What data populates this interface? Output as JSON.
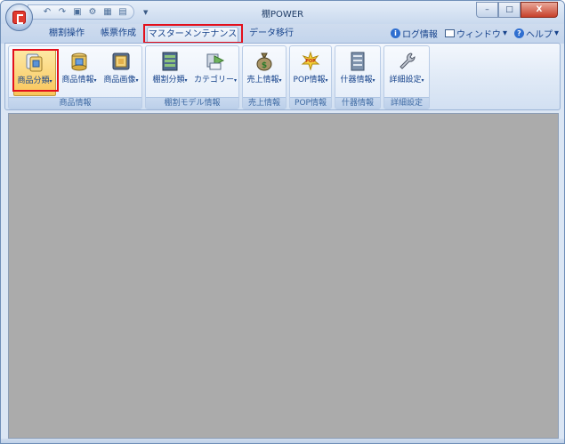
{
  "window": {
    "title": "棚POWER",
    "controls": {
      "minimize": "–",
      "maximize": "□",
      "close": "X"
    }
  },
  "quick_access": {
    "items": [
      {
        "name": "undo-icon",
        "glyph": "↶"
      },
      {
        "name": "redo-icon",
        "glyph": "↷"
      },
      {
        "name": "save-icon",
        "glyph": "▣"
      },
      {
        "name": "tool-icon",
        "glyph": "⚙"
      },
      {
        "name": "grid-icon",
        "glyph": "▦"
      },
      {
        "name": "layout-icon",
        "glyph": "▤"
      }
    ],
    "dropdown": "▼"
  },
  "tabs": [
    {
      "label": "棚割操作",
      "active": false
    },
    {
      "label": "帳票作成",
      "active": false
    },
    {
      "label": "マスターメンテナンス",
      "active": true
    },
    {
      "label": "データ移行",
      "active": false
    }
  ],
  "right_menu": {
    "log": "ログ情報",
    "window": "ウィンドウ",
    "help": "ヘルプ",
    "arrow": "▾"
  },
  "ribbon": {
    "groups": [
      {
        "label": "商品情報",
        "buttons": [
          {
            "label": "商品分類",
            "icon": "product-category-icon",
            "pressed": true
          },
          {
            "label": "商品情報",
            "icon": "product-info-icon",
            "pressed": false
          },
          {
            "label": "商品画像",
            "icon": "product-image-icon",
            "pressed": false
          }
        ]
      },
      {
        "label": "棚割モデル情報",
        "buttons": [
          {
            "label": "棚割分類",
            "icon": "shelf-category-icon",
            "pressed": false
          },
          {
            "label": "カテゴリー",
            "icon": "category-icon",
            "pressed": false
          }
        ]
      },
      {
        "label": "売上情報",
        "buttons": [
          {
            "label": "売上情報",
            "icon": "money-bag-icon",
            "pressed": false
          }
        ]
      },
      {
        "label": "POP情報",
        "buttons": [
          {
            "label": "POP情報",
            "icon": "pop-icon",
            "pressed": false
          }
        ]
      },
      {
        "label": "什器情報",
        "buttons": [
          {
            "label": "什器情報",
            "icon": "fixture-icon",
            "pressed": false
          }
        ]
      },
      {
        "label": "詳細設定",
        "buttons": [
          {
            "label": "詳細設定",
            "icon": "wrench-icon",
            "pressed": false
          }
        ]
      }
    ],
    "dropdown_arrow": "▾"
  }
}
